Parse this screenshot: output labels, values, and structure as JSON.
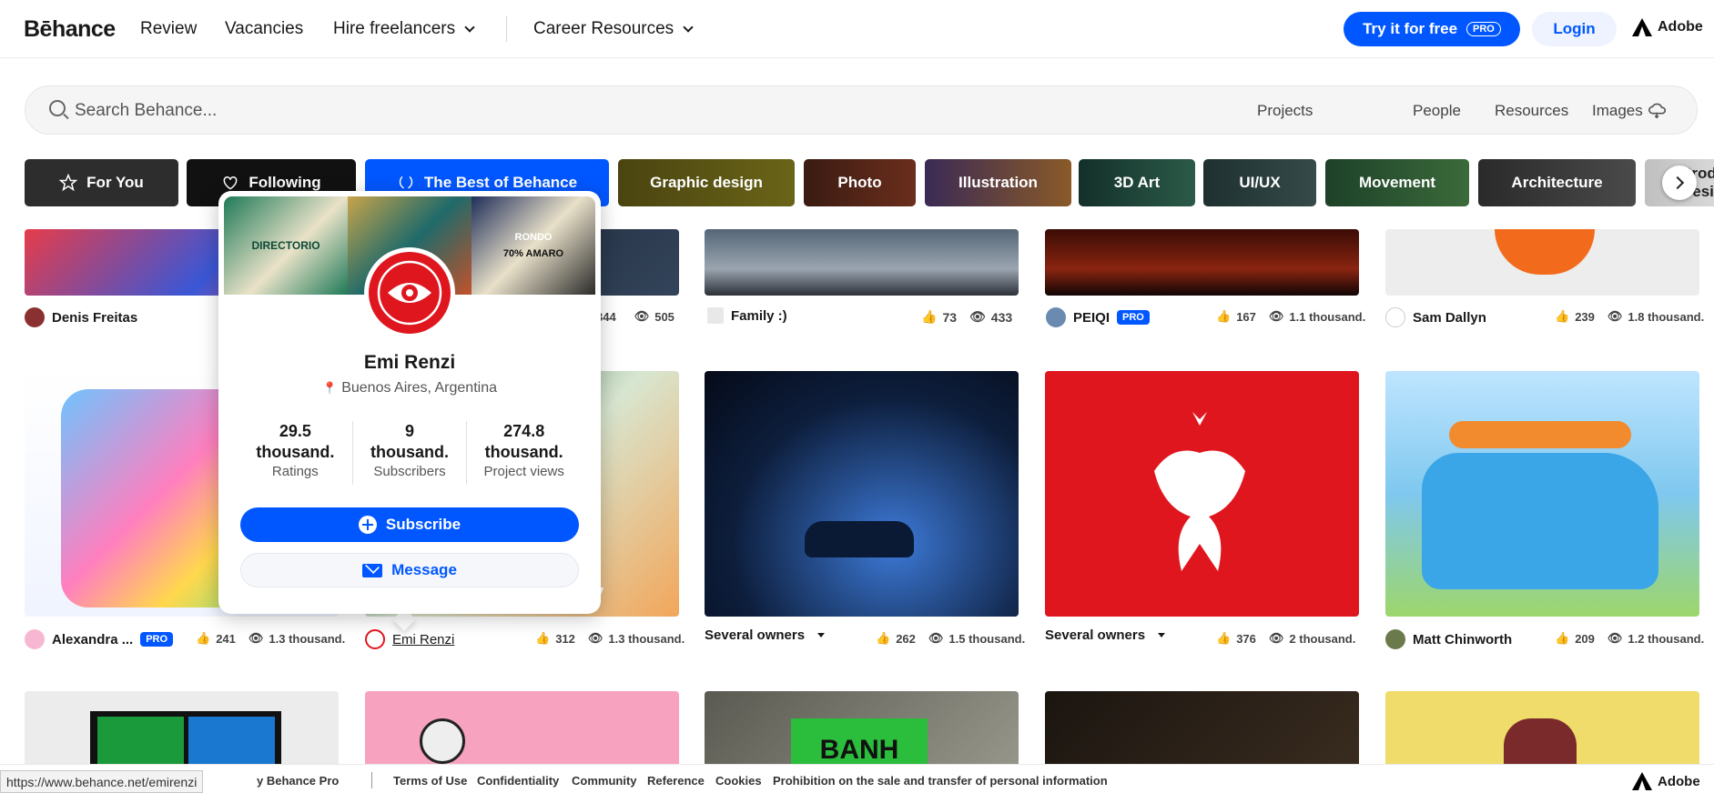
{
  "nav": {
    "logo": "Bēhance",
    "links": [
      "Review",
      "Vacancies",
      "Hire freelancers",
      "Career Resources"
    ],
    "try_label": "Try it for free",
    "pro_label": "PRO",
    "login_label": "Login",
    "adobe_label": "Adobe"
  },
  "search": {
    "placeholder": "Search Behance...",
    "filters": [
      "Projects",
      "People",
      "Resources",
      "Images"
    ]
  },
  "categories": [
    "For You",
    "Following",
    "The Best of Behance",
    "Graphic design",
    "Photo",
    "Illustration",
    "3D Art",
    "UI/UX",
    "Movement",
    "Architecture",
    "Product Design"
  ],
  "projects": [
    {
      "owner": "Denis Freitas",
      "likes": "",
      "views": ""
    },
    {
      "owner": "",
      "likes": "344",
      "views": "505"
    },
    {
      "owner": "Family :)",
      "likes": "73",
      "views": "433"
    },
    {
      "owner": "PEIQI",
      "pro": "PRO",
      "likes": "167",
      "views": "1.1 thousand."
    },
    {
      "owner": "Sam Dallyn",
      "likes": "239",
      "views": "1.8 thousand."
    },
    {
      "owner": "Alexandra ...",
      "pro": "PRO",
      "likes": "241",
      "views": "1.3 thousand."
    },
    {
      "owner": "Emi Renzi",
      "likes": "312",
      "views": "1.3 thousand."
    },
    {
      "owner": "Several owners",
      "likes": "262",
      "views": "1.5 thousand."
    },
    {
      "owner": "Several owners",
      "likes": "376",
      "views": "2 thousand."
    },
    {
      "owner": "Matt Chinworth",
      "likes": "209",
      "views": "1.2 thousand."
    }
  ],
  "popover": {
    "name": "Emi Renzi",
    "location": "Buenos Aires, Argentina",
    "stats": [
      {
        "value_a": "29.5",
        "value_b": "thousand.",
        "label": "Ratings"
      },
      {
        "value_a": "9",
        "value_b": "thousand.",
        "label": "Subscribers"
      },
      {
        "value_a": "274.8",
        "value_b": "thousand.",
        "label": "Project views"
      }
    ],
    "subscribe_label": "Subscribe",
    "message_label": "Message",
    "cover_texts": [
      "DIRECTORIO",
      "RONDO",
      "70% AMARO"
    ]
  },
  "overlay_texts": {
    "chip_1": "y",
    "image_9": "BANH"
  },
  "footer": {
    "links": [
      "y Behance Pro",
      "Terms of Use",
      "Confidentiality",
      "Community",
      "Reference",
      "Cookies",
      "Prohibition on the sale and transfer of personal information"
    ],
    "adobe_label": "Adobe"
  },
  "status_url": "https://www.behance.net/emirenzi"
}
